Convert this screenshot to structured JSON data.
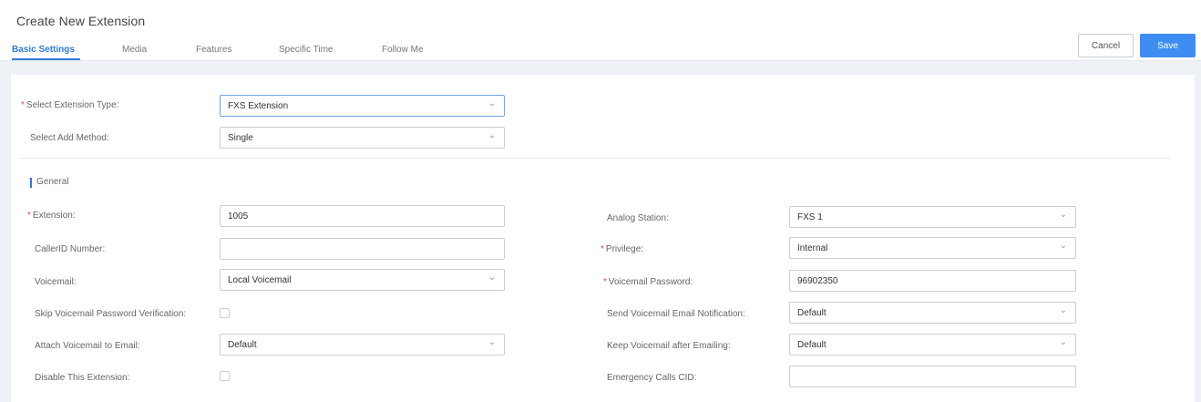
{
  "header": {
    "title": "Create New Extension",
    "cancel_label": "Cancel",
    "save_label": "Save"
  },
  "tabs": [
    {
      "label": "Basic Settings",
      "active": true
    },
    {
      "label": "Media",
      "active": false
    },
    {
      "label": "Features",
      "active": false
    },
    {
      "label": "Specific Time",
      "active": false
    },
    {
      "label": "Follow Me",
      "active": false
    }
  ],
  "top_fields": {
    "extension_type": {
      "label": "Select Extension Type:",
      "required": true,
      "value": "FXS Extension"
    },
    "add_method": {
      "label": "Select Add Method:",
      "required": false,
      "value": "Single"
    }
  },
  "section": {
    "title": "General"
  },
  "fields": {
    "extension": {
      "label": "Extension:",
      "required": true,
      "value": "1005"
    },
    "callerid": {
      "label": "CallerID Number:",
      "required": false,
      "value": ""
    },
    "voicemail": {
      "label": "Voicemail:",
      "required": false,
      "value": "Local Voicemail"
    },
    "skip_vm_pw": {
      "label": "Skip Voicemail Password Verification:",
      "required": false,
      "checked": false
    },
    "attach_vm": {
      "label": "Attach Voicemail to Email:",
      "required": false,
      "value": "Default"
    },
    "disable_ext": {
      "label": "Disable This Extension:",
      "required": false,
      "checked": false
    },
    "analog_station": {
      "label": "Analog Station:",
      "required": false,
      "value": "FXS 1"
    },
    "privilege": {
      "label": "Privilege:",
      "required": true,
      "value": "Internal"
    },
    "vm_password": {
      "label": "Voicemail Password:",
      "required": true,
      "value": "96902350"
    },
    "send_vm_email": {
      "label": "Send Voicemail Email Notification:",
      "required": false,
      "value": "Default"
    },
    "keep_vm": {
      "label": "Keep Voicemail after Emailing:",
      "required": false,
      "value": "Default"
    },
    "emergency_cid": {
      "label": "Emergency Calls CID:",
      "required": false,
      "value": ""
    }
  },
  "colors": {
    "accent": "#2f7bd9",
    "save_button": "#3d8ef0",
    "required_marker": "#e04b4b"
  }
}
